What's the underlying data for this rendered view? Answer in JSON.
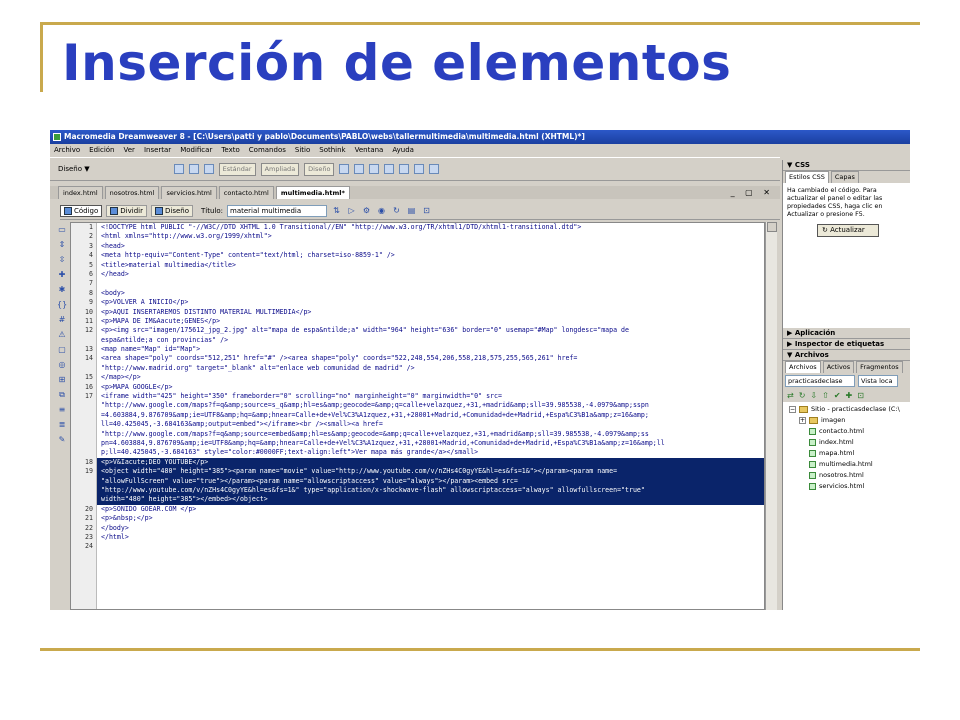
{
  "slide": {
    "title": "Inserción de elementos"
  },
  "window": {
    "title": "Macromedia Dreamweaver 8 - [C:\\Users\\patti y pablo\\Documents\\PABLO\\webs\\tallermultimedia\\multimedia.html (XHTML)*]",
    "menu": [
      "Archivo",
      "Edición",
      "Ver",
      "Insertar",
      "Modificar",
      "Texto",
      "Comandos",
      "Sitio",
      "Sothink",
      "Ventana",
      "Ayuda"
    ],
    "design_selector": "Diseño ▼",
    "toolbar_buttons": [
      "Estándar",
      "Ampliada",
      "Diseño"
    ],
    "doc_tabs": [
      "index.html",
      "nosotros.html",
      "servicios.html",
      "contacto.html",
      "multimedia.html*"
    ],
    "window_controls": "_ ▢ ✕",
    "views": {
      "code": "Código",
      "split": "Dividir",
      "design": "Diseño"
    },
    "title_label": "Título:",
    "title_value": "material multimedia"
  },
  "code_lines": [
    {
      "n": "1",
      "t": "<!DOCTYPE html PUBLIC \"-//W3C//DTD XHTML 1.0 Transitional//EN\" \"http://www.w3.org/TR/xhtml1/DTD/xhtml1-transitional.dtd\">"
    },
    {
      "n": "2",
      "t": "<html xmlns=\"http://www.w3.org/1999/xhtml\">"
    },
    {
      "n": "3",
      "t": "<head>"
    },
    {
      "n": "4",
      "t": "<meta http-equiv=\"Content-Type\" content=\"text/html; charset=iso-8859-1\" />"
    },
    {
      "n": "5",
      "t": "<title>material multimedia</title>"
    },
    {
      "n": "6",
      "t": "</head>"
    },
    {
      "n": "7",
      "t": ""
    },
    {
      "n": "8",
      "t": "<body>"
    },
    {
      "n": "9",
      "t": "<p>VOLVER A INICIO</p>"
    },
    {
      "n": "10",
      "t": "<p>AQUI INSERTAREMOS DISTINTO MATERIAL MULTIMEDIA</p>"
    },
    {
      "n": "11",
      "t": "<p>MAPA DE IM&Aacute;GENES</p>"
    },
    {
      "n": "12",
      "t": "<p><img src=\"imagen/175612_jpg_2.jpg\" alt=\"mapa de espa&ntilde;a\" width=\"964\" height=\"636\" border=\"0\" usemap=\"#Map\" longdesc=\"mapa de"
    },
    {
      "n": "",
      "t": "espa&ntilde;a con provincias\" />"
    },
    {
      "n": "13",
      "t": "<map name=\"Map\" id=\"Map\">"
    },
    {
      "n": "14",
      "t": "<area shape=\"poly\" coords=\"512,251\" href=\"#\" /><area shape=\"poly\" coords=\"522,248,554,206,558,218,575,255,565,261\" href="
    },
    {
      "n": "",
      "t": "\"http://www.madrid.org\" target=\"_blank\" alt=\"enlace web comunidad de madrid\" />"
    },
    {
      "n": "15",
      "t": "</map></p>"
    },
    {
      "n": "16",
      "t": "<p>MAPA GOOGLE</p>"
    },
    {
      "n": "17",
      "t": "<iframe width=\"425\" height=\"350\" frameborder=\"0\" scrolling=\"no\" marginheight=\"0\" marginwidth=\"0\" src="
    },
    {
      "n": "",
      "t": "\"http://www.google.com/maps?f=q&amp;source=s_q&amp;hl=es&amp;geocode=&amp;q=calle+velazquez,+31,+madrid&amp;sll=39.985538,-4.0979&amp;sspn"
    },
    {
      "n": "",
      "t": "=4.603884,9.876709&amp;ie=UTF8&amp;hq=&amp;hnear=Calle+de+Vel%C3%A1zquez,+31,+28001+Madrid,+Comunidad+de+Madrid,+Espa%C3%B1a&amp;z=16&amp;"
    },
    {
      "n": "",
      "t": "ll=40.425045,-3.684163&amp;output=embed\"></iframe><br /><small><a href="
    },
    {
      "n": "",
      "t": "\"http://www.google.com/maps?f=q&amp;source=embed&amp;hl=es&amp;geocode=&amp;q=calle+velazquez,+31,+madrid&amp;sll=39.985538,-4.0979&amp;ss"
    },
    {
      "n": "",
      "t": "pn=4.603884,9.876709&amp;ie=UTF8&amp;hq=&amp;hnear=Calle+de+Vel%C3%A1zquez,+31,+28001+Madrid,+Comunidad+de+Madrid,+Espa%C3%B1a&amp;z=16&amp;ll"
    },
    {
      "n": "",
      "t": "p;ll=40.425045,-3.684163\" style=\"color:#0000FF;text-align:left\">Ver mapa más grande</a></small>"
    },
    {
      "n": "18",
      "t": "<p>V&Iacute;DEO YOUTUBE</p>",
      "sel": true
    },
    {
      "n": "19",
      "t": "<object width=\"480\" height=\"385\"><param name=\"movie\" value=\"http://www.youtube.com/v/nZHs4C0gyYE&hl=es&fs=1&\"></param><param name=",
      "sel": true
    },
    {
      "n": "",
      "t": "\"allowFullScreen\" value=\"true\"></param><param name=\"allowscriptaccess\" value=\"always\"></param><embed src=",
      "sel": true
    },
    {
      "n": "",
      "t": "\"http://www.youtube.com/v/nZHs4C0gyYE&hl=es&fs=1&\" type=\"application/x-shockwave-flash\" allowscriptaccess=\"always\" allowfullscreen=\"true\"",
      "sel": true
    },
    {
      "n": "",
      "t": "width=\"480\" height=\"385\"></embed></object>",
      "sel": true
    },
    {
      "n": "20",
      "t": "<p>SONIDO GOEAR.COM </p>"
    },
    {
      "n": "21",
      "t": "<p>&nbsp;</p>"
    },
    {
      "n": "22",
      "t": "</body>"
    },
    {
      "n": "23",
      "t": "</html>"
    },
    {
      "n": "24",
      "t": ""
    }
  ],
  "right_panel": {
    "css_header": "▼ CSS",
    "css_tabs": [
      "Estilos CSS",
      "Capas"
    ],
    "css_message": "Ha cambiado el código. Para actualizar el panel o editar las propiedades CSS, haga clic en Actualizar o presione F5.",
    "update_button": "Actualizar",
    "app_header": "▶ Aplicación",
    "tag_inspector_header": "▶ Inspector de etiquetas",
    "files_header": "▼ Archivos",
    "files_tabs": [
      "Archivos",
      "Activos",
      "Fragmentos"
    ],
    "site_select": "practicasdeclase",
    "view_select": "Vista loca",
    "site_root": "Sitio - practicasdeclase (C:\\",
    "folder": "imagen",
    "files": [
      "contacto.html",
      "index.html",
      "mapa.html",
      "multimedia.html",
      "nosotros.html",
      "servicios.html"
    ]
  }
}
